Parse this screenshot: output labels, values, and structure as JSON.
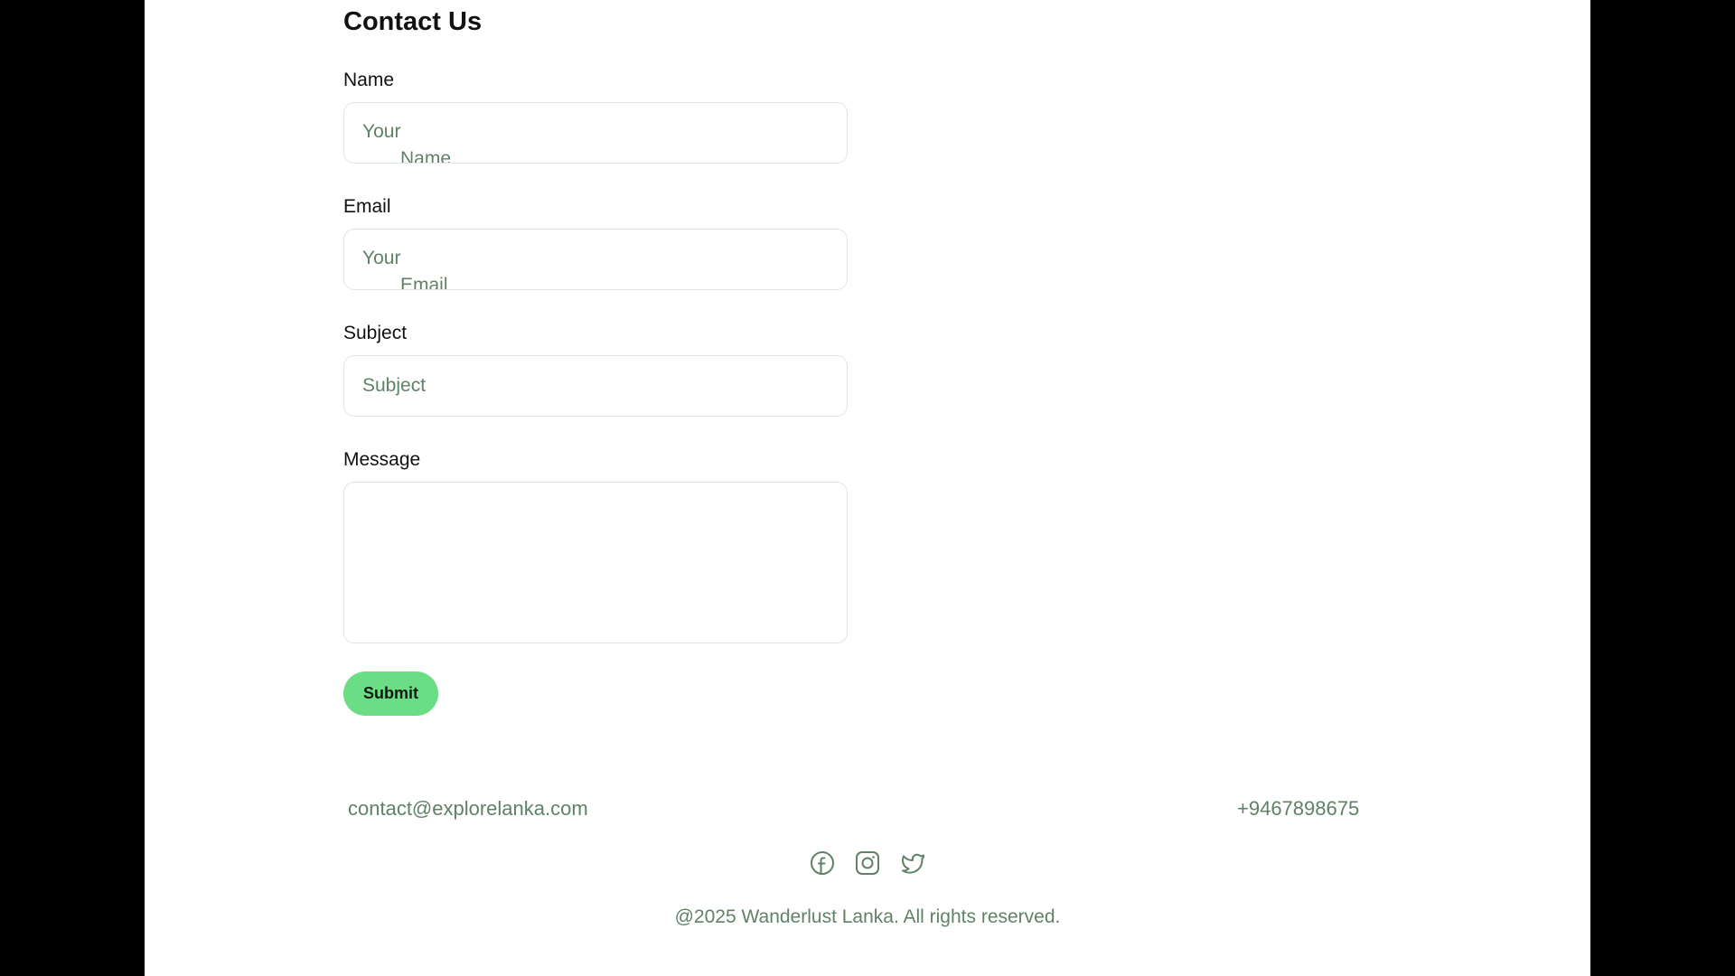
{
  "contact_form": {
    "title": "Contact Us",
    "fields": {
      "name": {
        "label": "Name",
        "placeholder_line1": "Your",
        "placeholder_line2": "Name"
      },
      "email": {
        "label": "Email",
        "placeholder_line1": "Your",
        "placeholder_line2": "Email"
      },
      "subject": {
        "label": "Subject",
        "placeholder": "Subject"
      },
      "message": {
        "label": "Message",
        "value": ""
      }
    },
    "submit_label": "Submit"
  },
  "footer": {
    "email": "contact@explorelanka.com",
    "phone": "+9467898675",
    "social_icons": [
      "facebook-icon",
      "instagram-icon",
      "twitter-icon"
    ],
    "copyright": "@2025 Wanderlust Lanka. All rights reserved."
  },
  "colors": {
    "accent": "#6bdd85",
    "muted_text": "#5f8266",
    "input_border": "#e1e4e8",
    "backdrop": "#000000",
    "page_background": "#ffffff"
  }
}
